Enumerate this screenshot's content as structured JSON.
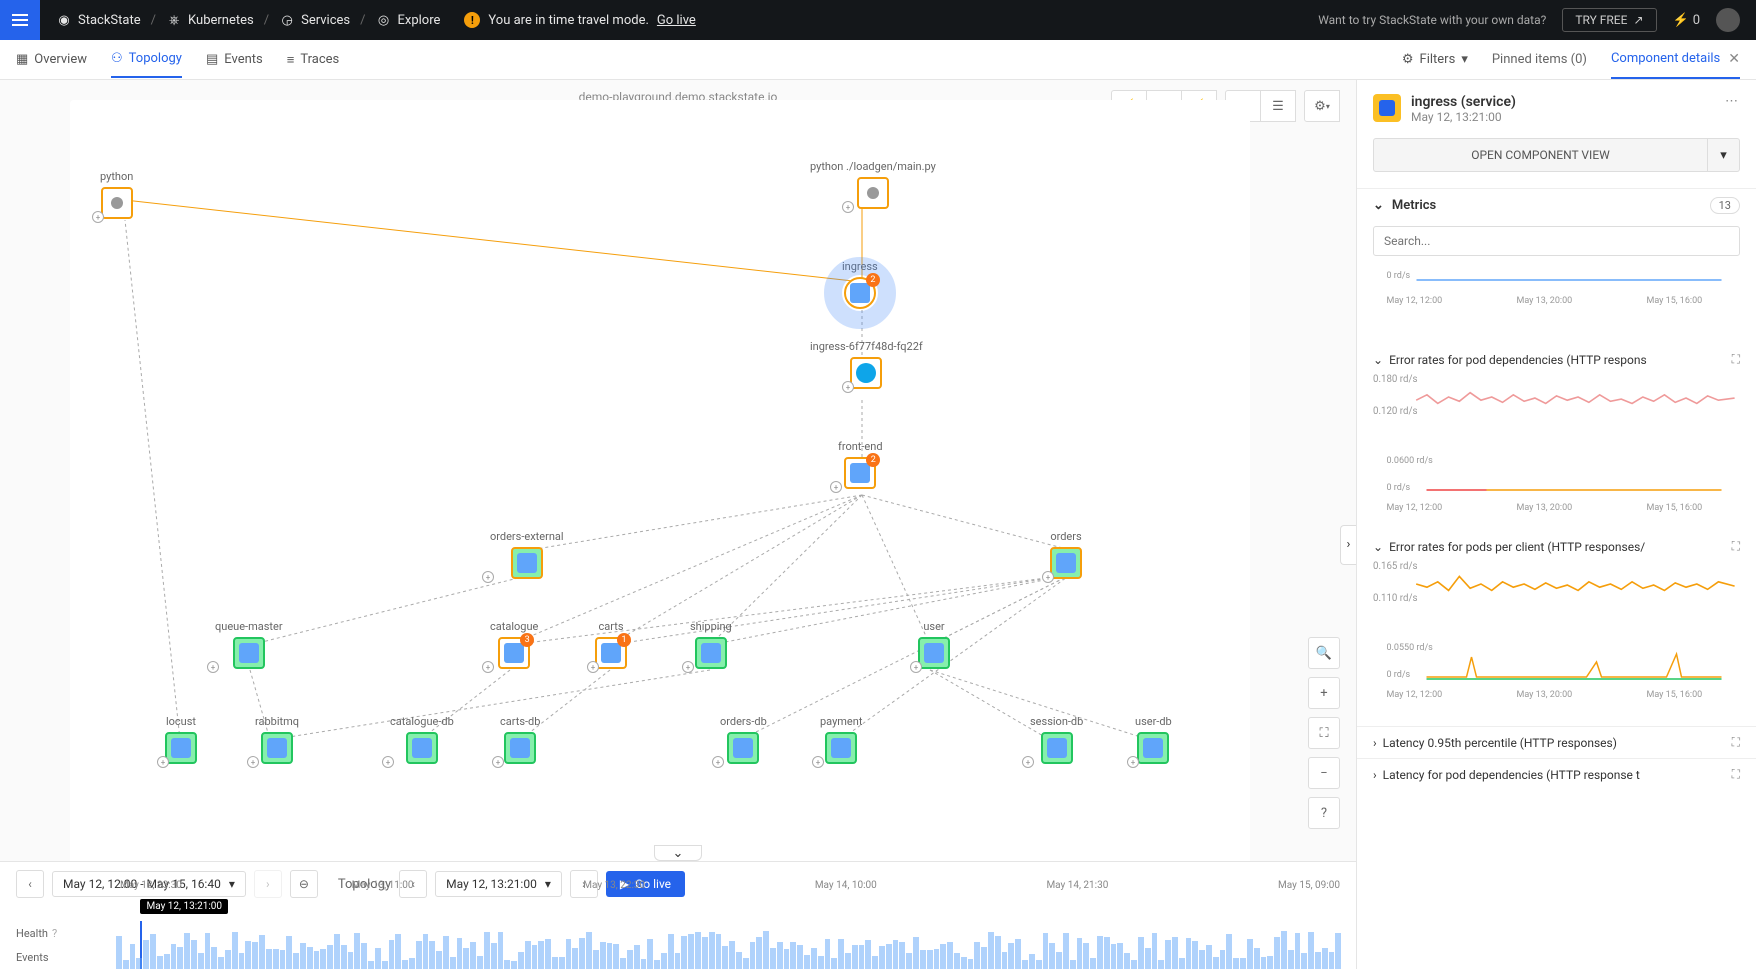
{
  "topbar": {
    "breadcrumb": [
      "StackState",
      "Kubernetes",
      "Services",
      "Explore"
    ],
    "warning": "You are in time travel mode.",
    "go_live": "Go live",
    "cta_text": "Want to try StackState with your own data?",
    "try_free": "TRY FREE",
    "notif_count": "0"
  },
  "subnav": {
    "items": [
      "Overview",
      "Topology",
      "Events",
      "Traces"
    ],
    "filters": "Filters",
    "pinned": "Pinned items (0)",
    "comp_details": "Component details"
  },
  "canvas": {
    "title": "demo-playground.demo.stackstate.io"
  },
  "nodes": {
    "python": "python",
    "loadgen": "python ./loadgen/main.py",
    "ingress": "ingress",
    "ingresspod": "ingress-6f77f48d-fq22f",
    "frontend": "front-end",
    "orders_external": "orders-external",
    "orders": "orders",
    "queue_master": "queue-master",
    "catalogue": "catalogue",
    "carts": "carts",
    "shipping": "shipping",
    "user": "user",
    "locust": "locust",
    "rabbitmq": "rabbitmq",
    "catalogue_db": "catalogue-db",
    "carts_db": "carts-db",
    "orders_db": "orders-db",
    "payment": "payment",
    "session_db": "session-db",
    "user_db": "user-db",
    "badge2": "2",
    "badge3": "3",
    "badge1": "1"
  },
  "timeline": {
    "range": "May 12, 12:00 - May 15, 16:40",
    "topology_label": "Topology",
    "time": "May 12, 13:21:00",
    "go_live": "Go live",
    "health": "Health",
    "events": "Events",
    "marker": "May 12, 13:21:00",
    "ticks": [
      "May 12, 23:30",
      "May 13, 11:00",
      "May 13, 22:30",
      "May 14, 10:00",
      "May 14, 21:30",
      "May 15, 09:00"
    ]
  },
  "details": {
    "title": "ingress (service)",
    "subtitle": "May 12, 13:21:00",
    "open_view": "OPEN COMPONENT VIEW",
    "metrics": "Metrics",
    "metrics_count": "13",
    "search_ph": "Search...",
    "chart1_title": "Error rates for pod dependencies (HTTP respons",
    "chart2_title": "Error rates for pods per client (HTTP responses/",
    "latency1": "Latency 0.95th percentile (HTTP responses)",
    "latency2": "Latency for pod dependencies (HTTP response t"
  },
  "chart_data": [
    {
      "type": "line",
      "title": "",
      "ylabel": "rd/s",
      "ylim": [
        0,
        1
      ],
      "x_ticks": [
        "May 12, 12:00",
        "May 13, 20:00",
        "May 15, 16:00"
      ],
      "series": [
        {
          "name": "rate",
          "values_approx": "flat near 0"
        }
      ]
    },
    {
      "type": "line",
      "title": "Error rates for pod dependencies (HTTP responses)",
      "ylabel": "rd/s",
      "y_ticks": [
        "0.180 rd/s",
        "0.120 rd/s",
        "0.0600 rd/s",
        "0 rd/s"
      ],
      "x_ticks": [
        "May 12, 12:00",
        "May 13, 20:00",
        "May 15, 16:00"
      ],
      "series": [
        {
          "name": "series1",
          "color": "#ef9a9a",
          "values_approx": "noisy around 0.14-0.16"
        },
        {
          "name": "series2",
          "color": "#f59e0b",
          "values_approx": "flat near 0"
        }
      ]
    },
    {
      "type": "line",
      "title": "Error rates for pods per client (HTTP responses/s)",
      "ylabel": "rd/s",
      "y_ticks": [
        "0.165 rd/s",
        "0.110 rd/s",
        "0.0550 rd/s",
        "0 rd/s"
      ],
      "x_ticks": [
        "May 12, 12:00",
        "May 13, 20:00",
        "May 15, 16:00"
      ],
      "series": [
        {
          "name": "series1",
          "color": "#f59e0b",
          "values_approx": "noisy around 0.13 with spikes to 0.16"
        },
        {
          "name": "series2",
          "color": "#22c55e",
          "values_approx": "flat near 0 with occasional small spikes"
        }
      ]
    }
  ]
}
